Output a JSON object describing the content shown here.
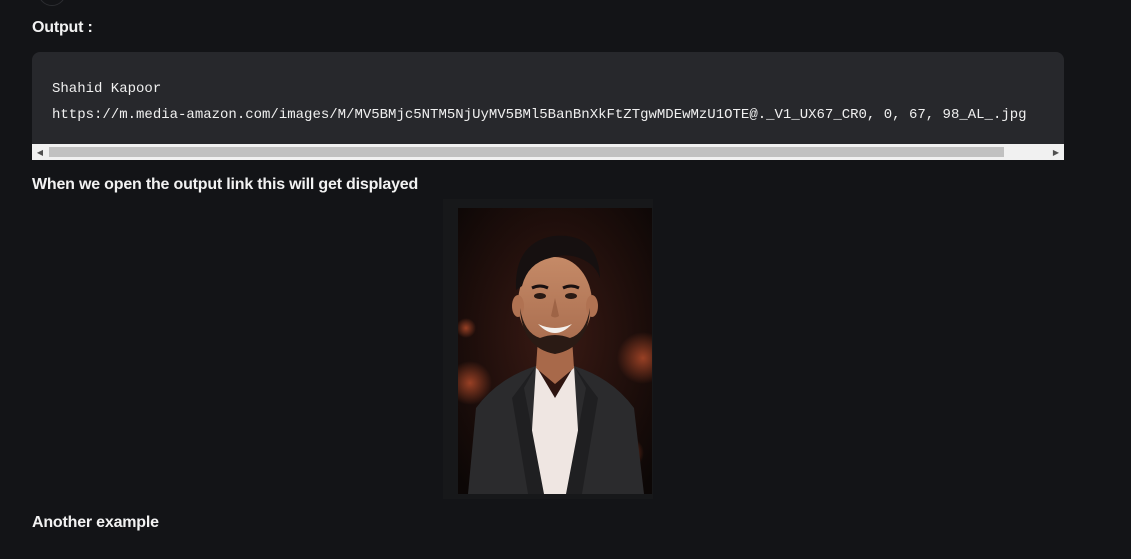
{
  "output_heading": "Output :",
  "code": {
    "line1": "Shahid Kapoor",
    "line2": "https://m.media-amazon.com/images/M/MV5BMjc5NTM5NjUyMV5BMl5BanBnXkFtZTgwMDEwMzU1OTE@._V1_UX67_CR0, 0, 67, 98_AL_.jpg"
  },
  "caption": "When we open the output link this will get displayed",
  "another_heading": "Another example",
  "icons": {
    "scroll_left": "chevron-left-icon",
    "scroll_right": "chevron-right-icon"
  }
}
